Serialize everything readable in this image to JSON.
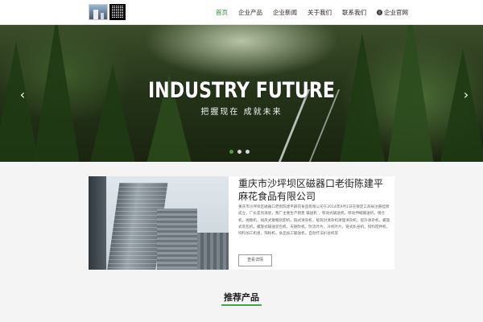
{
  "header": {
    "nav": [
      {
        "label": "首页",
        "active": true
      },
      {
        "label": "企业产品",
        "active": false
      },
      {
        "label": "企业新闻",
        "active": false
      },
      {
        "label": "关于我们",
        "active": false
      },
      {
        "label": "联系我们",
        "active": false
      },
      {
        "label": "企业官网",
        "active": false,
        "icon": "globe-icon"
      }
    ]
  },
  "banner": {
    "title": "INDUSTRY FUTURE",
    "subtitle": "把握现在 成就未来",
    "slide_count": 3,
    "active_slide": 1
  },
  "about": {
    "title": "重庆市沙坪坝区磁器口老街陈建平麻花食品有限公司",
    "text": "重庆市沙坪坝区磁器口老街陈建平麻花食品有限公司于2014年9月1日在保定工商局注册挂牌成立，厂长是肖海星，我厂主要生产销售 输送机 、移动式输送机，移动伸缩输送机，储仓机，抛粮机，如风式散粮装卸机，链式清杂机，极筑封清杂机清理清杂机，提升清杂机，螺旋式装包机，螺旋式输送装包机，天随吹机，吹流叶片，冷机叶片，链式扒谷机，饲料搅拌机，饲料加工机组，筛粉机，食品加工输送机，自动疗法扒谷机等",
    "details_button": "查看详情"
  },
  "recommended": {
    "title": "推荐产品"
  },
  "colors": {
    "accent": "#49a04c",
    "nav_active": "#2e8b3a"
  }
}
